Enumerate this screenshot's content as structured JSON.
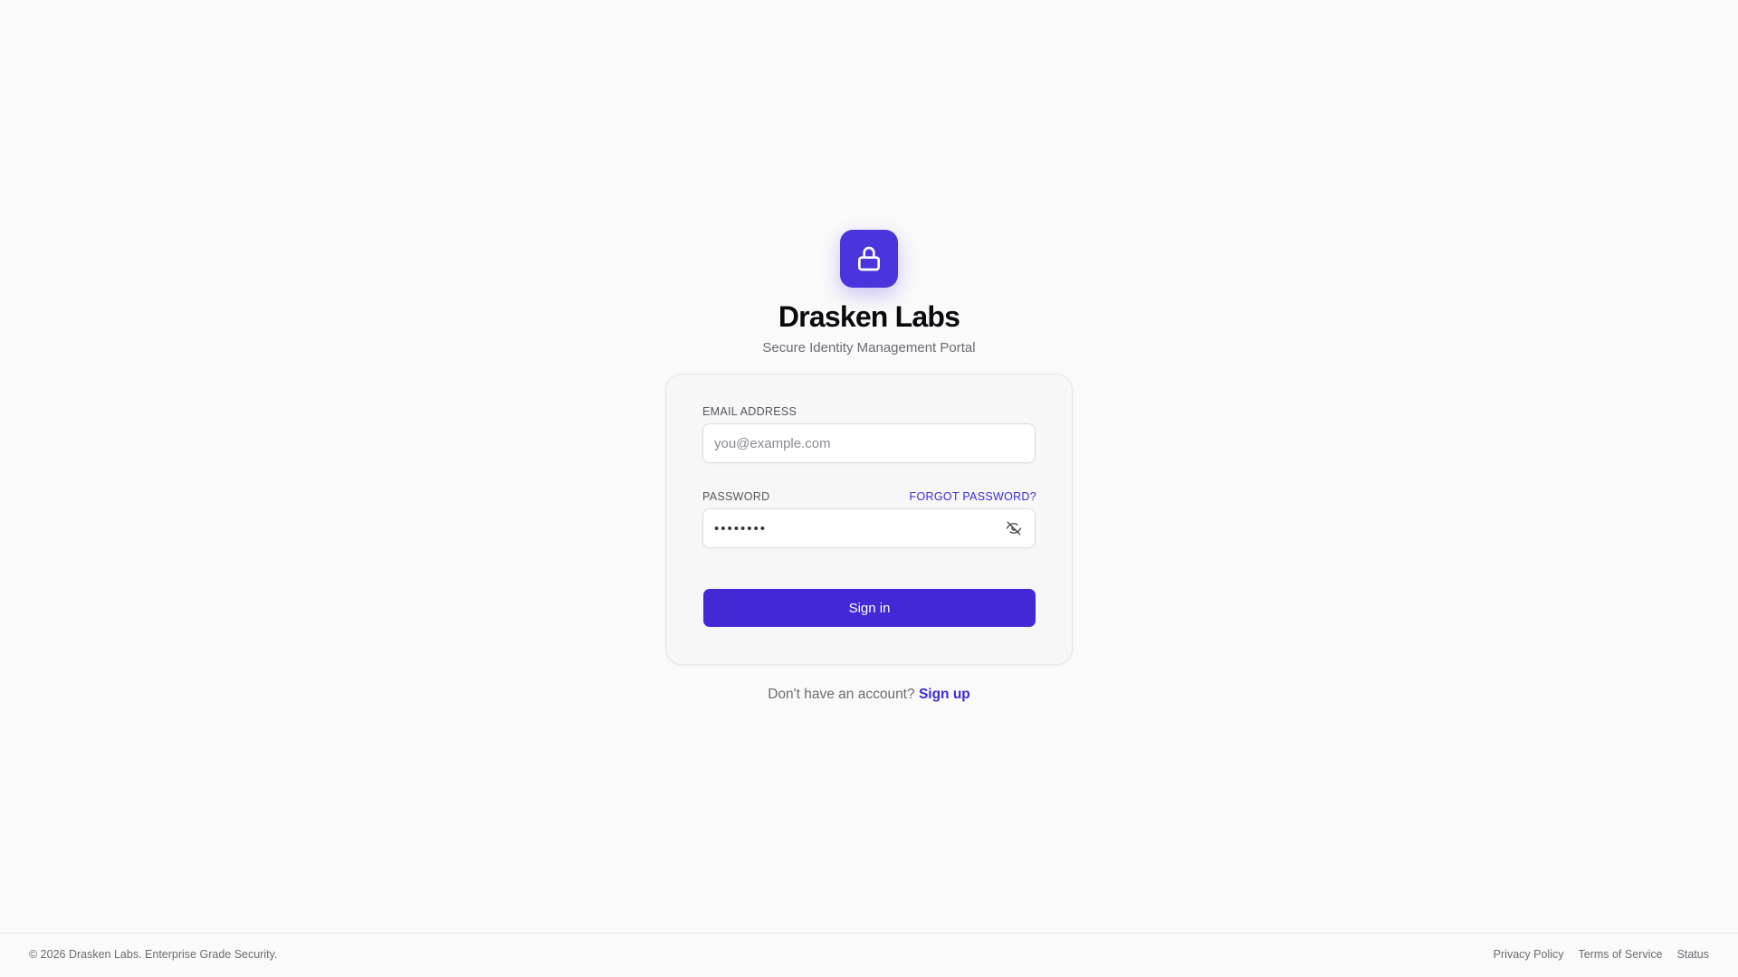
{
  "brand": {
    "logo_icon": "lock-icon",
    "accent_color": "#4a35dd",
    "title": "Drasken Labs",
    "subtitle": "Secure Identity Management Portal"
  },
  "form": {
    "email_label": "EMAIL ADDRESS",
    "email_placeholder": "you@example.com",
    "email_value": "",
    "password_label": "PASSWORD",
    "forgot_password": "FORGOT PASSWORD?",
    "password_value": "password",
    "password_toggle_icon": "eye-off-icon",
    "submit_label": "Sign in"
  },
  "signup": {
    "prompt": "Don't have an account?",
    "link": "Sign up"
  },
  "footer": {
    "copyright": "© 2026 Drasken Labs. Enterprise Grade Security.",
    "links": [
      "Privacy Policy",
      "Terms of Service",
      "Status"
    ]
  }
}
